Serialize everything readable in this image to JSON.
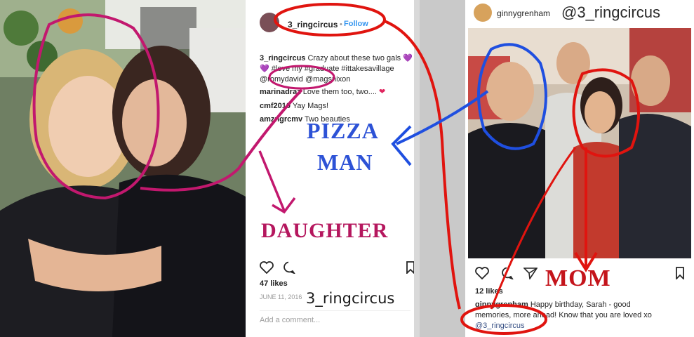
{
  "left_post": {
    "username": "3_ringcircus",
    "follow_label": "Follow",
    "caption_user": "3_ringcircus",
    "caption_text": "Crazy about these two gals",
    "caption_line2": "#love my #graduate #ittakesavillage",
    "caption_line3": "@romydavid @magsnixon",
    "comments": [
      {
        "user": "marinadraz",
        "text": "Love them too, two....",
        "emoji": "❤"
      },
      {
        "user": "cmf2010",
        "text": "Yay Mags!"
      },
      {
        "user": "amzngrcmv",
        "text": "Two beauties"
      }
    ],
    "likes": "47 likes",
    "date": "JUNE 11, 2016",
    "add_comment_placeholder": "Add a comment...",
    "watermark": "3_ringcircus"
  },
  "right_post": {
    "username": "ginnygrenham",
    "handle_overlay": "@3_ringcircus",
    "likes": "12 likes",
    "caption_user": "ginnygrenham",
    "caption_text": "Happy birthday, Sarah - good",
    "caption_line2": "memories, more ahead! Know that you are loved xo",
    "caption_line3": "@3_ringcircus"
  },
  "annotations": {
    "pizza": "PIZZA",
    "man": "MAN",
    "daughter": "DAUGHTER",
    "mom": "MOM"
  },
  "colors": {
    "annotation_red": "#e0140f",
    "annotation_magenta": "#c2186e",
    "annotation_blue": "#1f4fe0",
    "daughter_text": "#b5175e",
    "mom_text": "#c4141b",
    "pizza_text": "#2d52d6",
    "link_blue": "#3897f0"
  },
  "icons": [
    "heart-icon",
    "comment-icon",
    "share-icon",
    "bookmark-icon"
  ]
}
